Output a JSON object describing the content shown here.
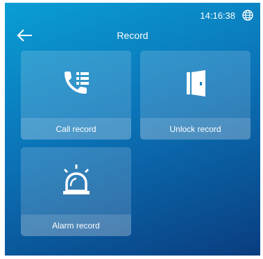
{
  "status": {
    "time": "14:16:38",
    "globe_icon": "globe-icon"
  },
  "header": {
    "back_icon": "back-arrow-icon",
    "title": "Record"
  },
  "tiles": [
    {
      "label": "Call record",
      "icon": "call-record-icon"
    },
    {
      "label": "Unlock record",
      "icon": "door-unlock-icon"
    },
    {
      "label": "Alarm record",
      "icon": "alarm-siren-icon"
    }
  ],
  "colors": {
    "background_top": "#0a9ed4",
    "background_bottom": "#0a3d80",
    "text": "#ffffff"
  }
}
